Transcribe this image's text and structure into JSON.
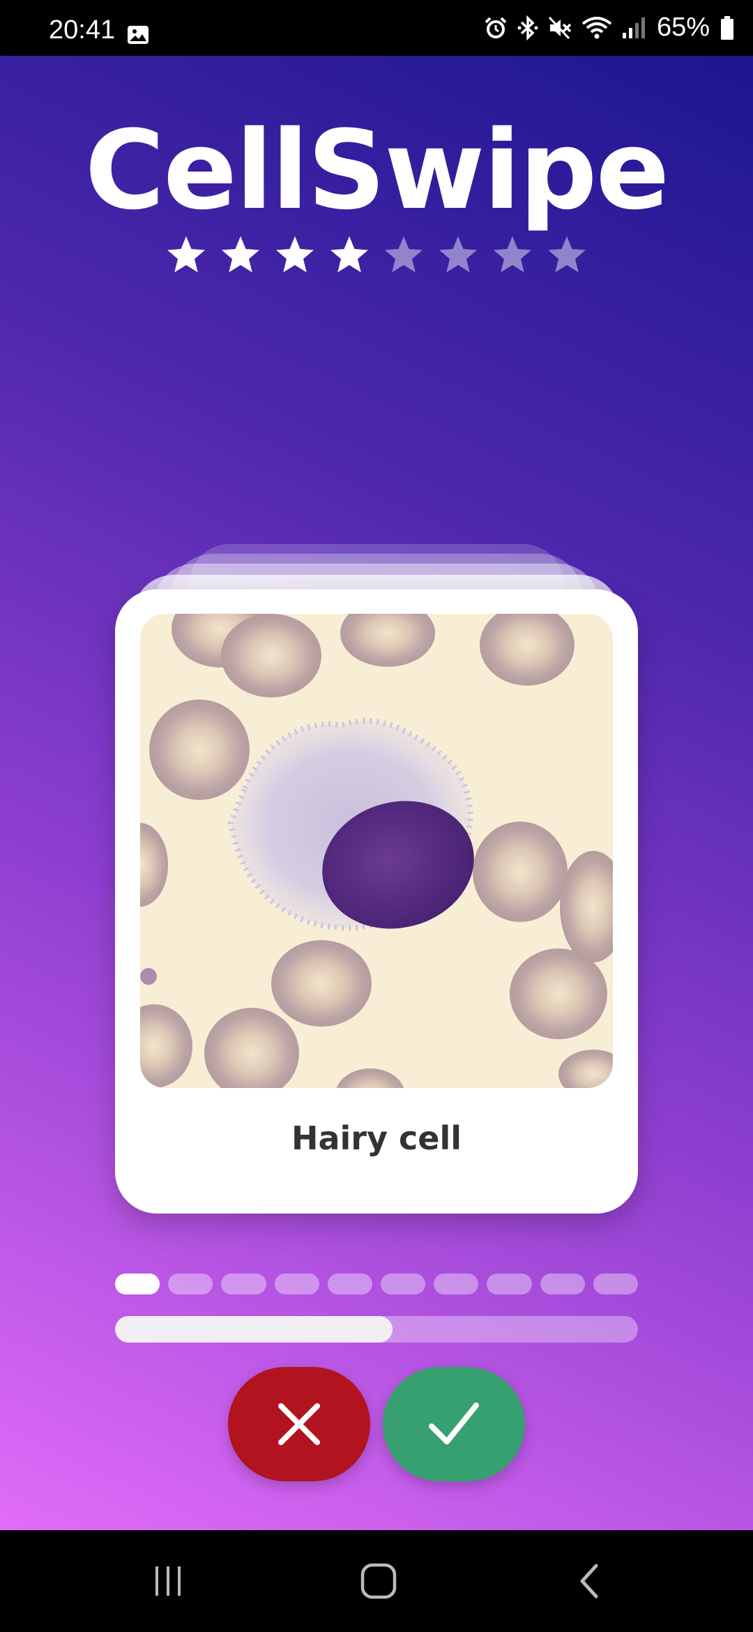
{
  "status_bar": {
    "time": "20:41",
    "battery": "65%",
    "icons": [
      "gallery-icon",
      "alarm-icon",
      "bluetooth-icon",
      "mute-icon",
      "wifi-icon",
      "signal-icon",
      "battery-icon"
    ]
  },
  "app": {
    "title": "CellSwipe",
    "rating": {
      "filled": 4,
      "total": 8
    }
  },
  "card": {
    "label": "Hairy cell",
    "image": "blood-smear-hairy-cell"
  },
  "pagination": {
    "total": 10,
    "current": 1
  },
  "progress": {
    "fraction": 0.53
  },
  "actions": {
    "reject_icon": "close-icon",
    "accept_icon": "check-icon"
  },
  "nav_bar": {
    "icons": [
      "recents-icon",
      "home-icon",
      "back-icon"
    ]
  },
  "colors": {
    "reject": "#b1131f",
    "accept": "#37a070",
    "gradient_top": "#1c1690",
    "gradient_bottom": "#e16cf8"
  }
}
